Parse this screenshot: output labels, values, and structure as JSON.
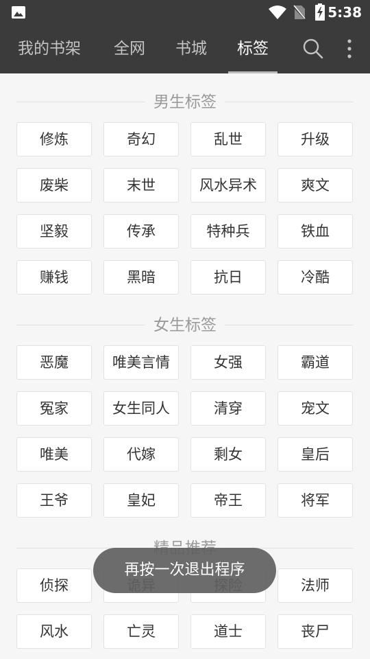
{
  "status": {
    "time": "5:38"
  },
  "tabs": [
    {
      "label": "我的书架"
    },
    {
      "label": "全网"
    },
    {
      "label": "书城"
    },
    {
      "label": "标签"
    }
  ],
  "sections": [
    {
      "title": "男生标签",
      "tags": [
        "修炼",
        "奇幻",
        "乱世",
        "升级",
        "废柴",
        "末世",
        "风水异术",
        "爽文",
        "坚毅",
        "传承",
        "特种兵",
        "铁血",
        "赚钱",
        "黑暗",
        "抗日",
        "冷酷"
      ]
    },
    {
      "title": "女生标签",
      "tags": [
        "恶魔",
        "唯美言情",
        "女强",
        "霸道",
        "冤家",
        "女生同人",
        "清穿",
        "宠文",
        "唯美",
        "代嫁",
        "剩女",
        "皇后",
        "王爷",
        "皇妃",
        "帝王",
        "将军"
      ]
    },
    {
      "title": "精品推荐",
      "tags": [
        "侦探",
        "诡异",
        "探险",
        "法师",
        "风水",
        "亡灵",
        "道士",
        "丧尸"
      ]
    }
  ],
  "toast": {
    "text": "再按一次退出程序"
  }
}
